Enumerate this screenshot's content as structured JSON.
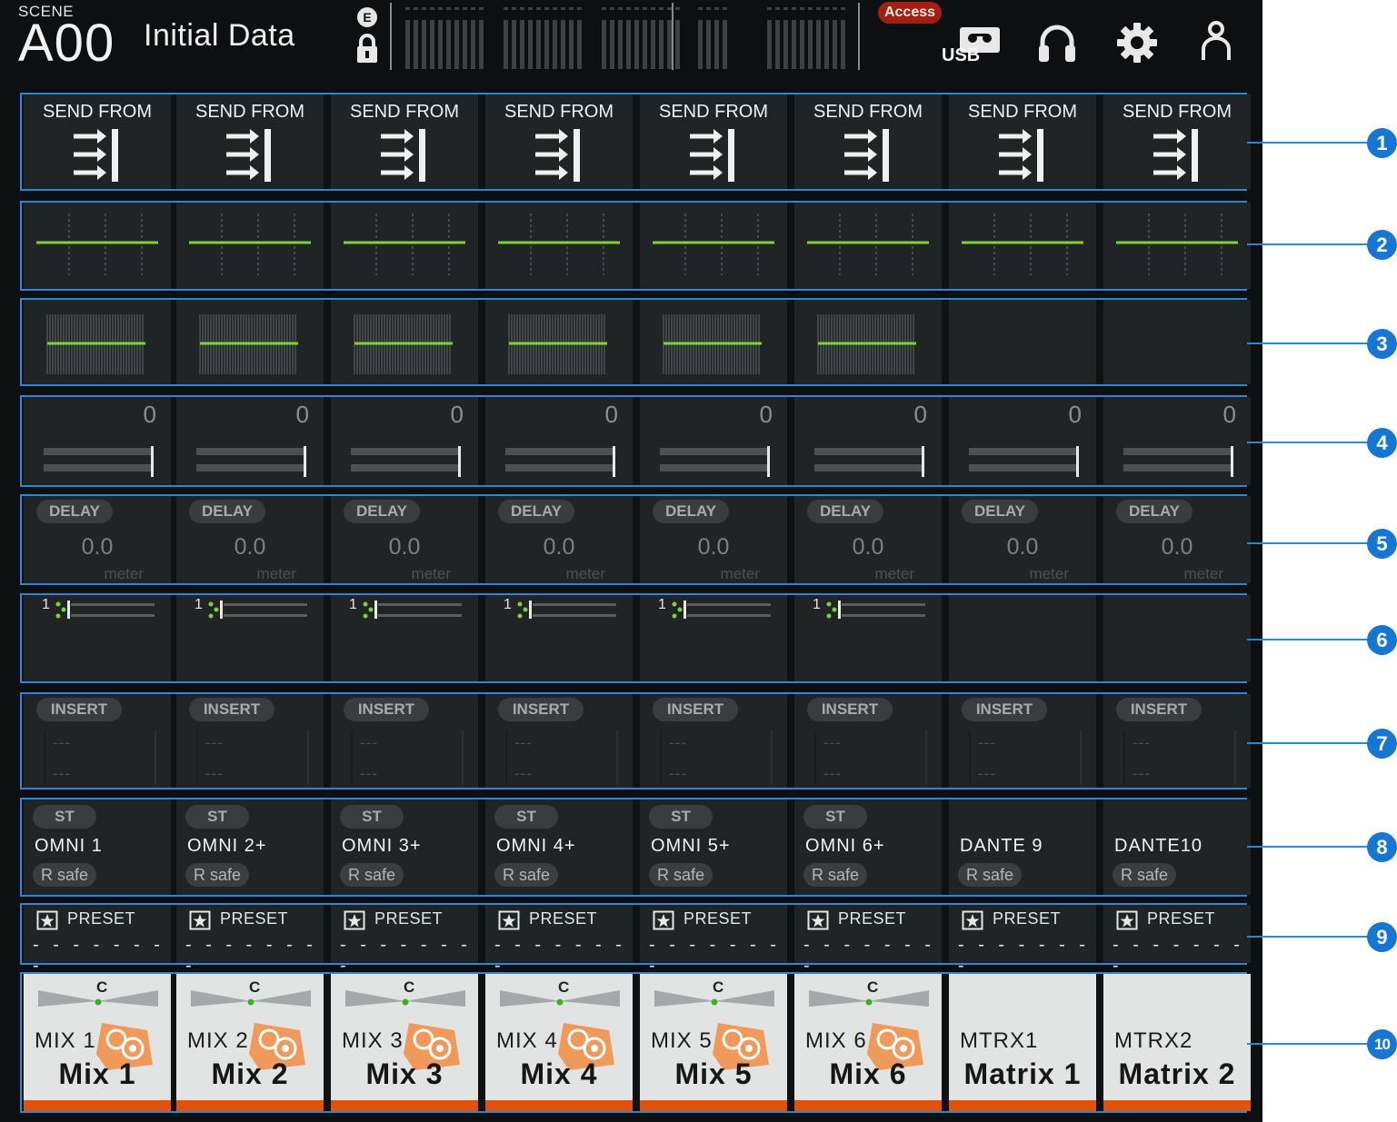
{
  "header": {
    "scene_label": "SCENE",
    "scene_number": "A00",
    "scene_name": "Initial Data",
    "edit_badge": "E",
    "access_badge": "Access",
    "usb_label": "USB",
    "colors": {
      "accent": "#2f86d8",
      "access": "#a31f12",
      "channel_bar": "#e0520a",
      "eq_line": "#7ed23a"
    }
  },
  "callouts": [
    "1",
    "2",
    "3",
    "4",
    "5",
    "6",
    "7",
    "8",
    "9",
    "10"
  ],
  "send_from": {
    "label": "SEND FROM",
    "icon": "send-from-icon"
  },
  "delay": {
    "label": "DELAY",
    "value": "0.0",
    "unit": "meter"
  },
  "insert": {
    "label": "INSERT",
    "line1": "---",
    "line2": "---"
  },
  "preset": {
    "label": "PRESET",
    "value": "- - - - - - - -"
  },
  "rsafe": {
    "label": "R safe"
  },
  "st_label": "ST",
  "pan_center": "C",
  "dyn_number": "1",
  "channels": [
    {
      "id": "MIX 1",
      "name": "Mix 1",
      "gain": "0",
      "port": "OMNI 1",
      "st": true,
      "eq": true,
      "dyn": true,
      "speaker": true
    },
    {
      "id": "MIX 2",
      "name": "Mix 2",
      "gain": "0",
      "port": "OMNI 2+",
      "st": true,
      "eq": true,
      "dyn": true,
      "speaker": true
    },
    {
      "id": "MIX 3",
      "name": "Mix 3",
      "gain": "0",
      "port": "OMNI 3+",
      "st": true,
      "eq": true,
      "dyn": true,
      "speaker": true
    },
    {
      "id": "MIX 4",
      "name": "Mix 4",
      "gain": "0",
      "port": "OMNI 4+",
      "st": true,
      "eq": true,
      "dyn": true,
      "speaker": true
    },
    {
      "id": "MIX 5",
      "name": "Mix 5",
      "gain": "0",
      "port": "OMNI 5+",
      "st": true,
      "eq": true,
      "dyn": true,
      "speaker": true
    },
    {
      "id": "MIX 6",
      "name": "Mix 6",
      "gain": "0",
      "port": "OMNI 6+",
      "st": true,
      "eq": true,
      "dyn": true,
      "speaker": true
    },
    {
      "id": "MTRX1",
      "name": "Matrix 1",
      "gain": "0",
      "port": "DANTE 9",
      "st": false,
      "eq": false,
      "dyn": false,
      "speaker": false
    },
    {
      "id": "MTRX2",
      "name": "Matrix 2",
      "gain": "0",
      "port": "DANTE10",
      "st": false,
      "eq": false,
      "dyn": false,
      "speaker": false
    }
  ]
}
